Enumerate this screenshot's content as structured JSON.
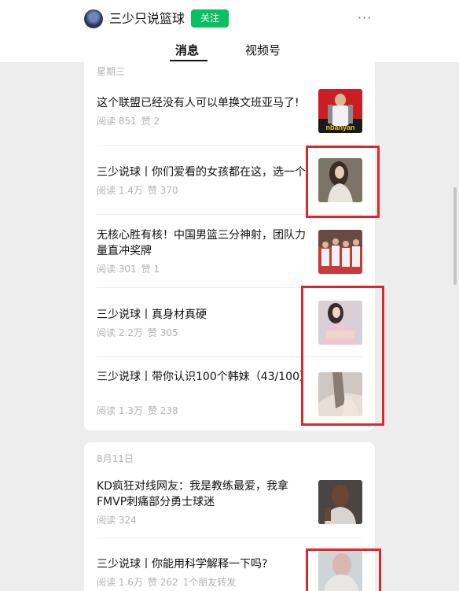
{
  "header": {
    "account_name": "三少只说篮球",
    "follow_label": "关注",
    "more_icon": "more-horizontal-icon",
    "tabs": [
      "消息",
      "视频号"
    ]
  },
  "groups": [
    {
      "date": "星期三",
      "articles": [
        {
          "title": "这个联盟已经没有人可以单换文班亚马了!",
          "reads": "阅读 851",
          "likes": "赞 2",
          "extra": ""
        },
        {
          "title": "三少说球丨你们爱看的女孩都在这，选一个",
          "reads": "阅读 1.4万",
          "likes": "赞 370",
          "extra": ""
        },
        {
          "title": "无核心胜有核！中国男篮三分神射，团队力量直冲奖牌",
          "reads": "阅读 301",
          "likes": "赞 1",
          "extra": ""
        },
        {
          "title": "三少说球丨真身材真硬",
          "reads": "阅读 2.2万",
          "likes": "赞 305",
          "extra": ""
        },
        {
          "title": "三少说球丨带你认识100个韩妹（43/100）",
          "reads": "阅读 1.3万",
          "likes": "赞 238",
          "extra": ""
        }
      ]
    },
    {
      "date": "8月11日",
      "articles": [
        {
          "title": "KD疯狂对线网友：我是教练最爱，我拿FMVP刺痛部分勇士球迷",
          "reads": "阅读 324",
          "likes": "",
          "extra": ""
        },
        {
          "title": "三少说球丨你能用科学解释一下吗?",
          "reads": "阅读 1.6万",
          "likes": "赞 262",
          "extra": "1个朋友转发"
        }
      ]
    }
  ],
  "colors": {
    "follow_green": "#07c160",
    "highlight_red": "#e0262c",
    "meta_gray": "#b2b2b2"
  }
}
